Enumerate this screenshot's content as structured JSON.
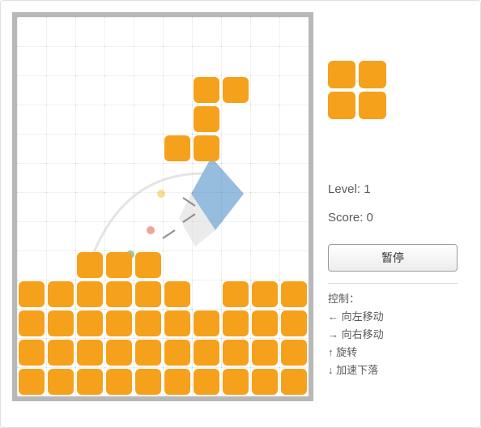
{
  "board": {
    "cols": 10,
    "rows": 13,
    "cells": [
      {
        "r": 2,
        "c": 6
      },
      {
        "r": 2,
        "c": 7
      },
      {
        "r": 3,
        "c": 6
      },
      {
        "r": 4,
        "c": 5
      },
      {
        "r": 4,
        "c": 6
      },
      {
        "r": 8,
        "c": 2
      },
      {
        "r": 8,
        "c": 3
      },
      {
        "r": 8,
        "c": 4
      },
      {
        "r": 9,
        "c": 0
      },
      {
        "r": 9,
        "c": 1
      },
      {
        "r": 9,
        "c": 2
      },
      {
        "r": 9,
        "c": 3
      },
      {
        "r": 9,
        "c": 4
      },
      {
        "r": 9,
        "c": 5
      },
      {
        "r": 9,
        "c": 7
      },
      {
        "r": 9,
        "c": 8
      },
      {
        "r": 9,
        "c": 9
      },
      {
        "r": 10,
        "c": 0
      },
      {
        "r": 10,
        "c": 1
      },
      {
        "r": 10,
        "c": 2
      },
      {
        "r": 10,
        "c": 3
      },
      {
        "r": 10,
        "c": 4
      },
      {
        "r": 10,
        "c": 5
      },
      {
        "r": 10,
        "c": 6
      },
      {
        "r": 10,
        "c": 7
      },
      {
        "r": 10,
        "c": 8
      },
      {
        "r": 10,
        "c": 9
      },
      {
        "r": 11,
        "c": 0
      },
      {
        "r": 11,
        "c": 1
      },
      {
        "r": 11,
        "c": 2
      },
      {
        "r": 11,
        "c": 3
      },
      {
        "r": 11,
        "c": 4
      },
      {
        "r": 11,
        "c": 5
      },
      {
        "r": 11,
        "c": 6
      },
      {
        "r": 11,
        "c": 7
      },
      {
        "r": 11,
        "c": 8
      },
      {
        "r": 11,
        "c": 9
      },
      {
        "r": 12,
        "c": 0
      },
      {
        "r": 12,
        "c": 1
      },
      {
        "r": 12,
        "c": 2
      },
      {
        "r": 12,
        "c": 3
      },
      {
        "r": 12,
        "c": 4
      },
      {
        "r": 12,
        "c": 5
      },
      {
        "r": 12,
        "c": 6
      },
      {
        "r": 12,
        "c": 7
      },
      {
        "r": 12,
        "c": 8
      },
      {
        "r": 12,
        "c": 9
      }
    ]
  },
  "preview": {
    "shape": "square",
    "cells": [
      {
        "r": 0,
        "c": 0
      },
      {
        "r": 0,
        "c": 1
      },
      {
        "r": 1,
        "c": 0
      },
      {
        "r": 1,
        "c": 1
      }
    ]
  },
  "stats": {
    "level_label": "Level:",
    "level_value": "1",
    "score_label": "Score:",
    "score_value": "0"
  },
  "pause_label": "暂停",
  "controls": {
    "title": "控制：",
    "left": "← 向左移动",
    "right": "→ 向右移动",
    "rotate": "↑ 旋转",
    "drop": "↓ 加速下落"
  },
  "colors": {
    "block": "#f5a11b"
  }
}
